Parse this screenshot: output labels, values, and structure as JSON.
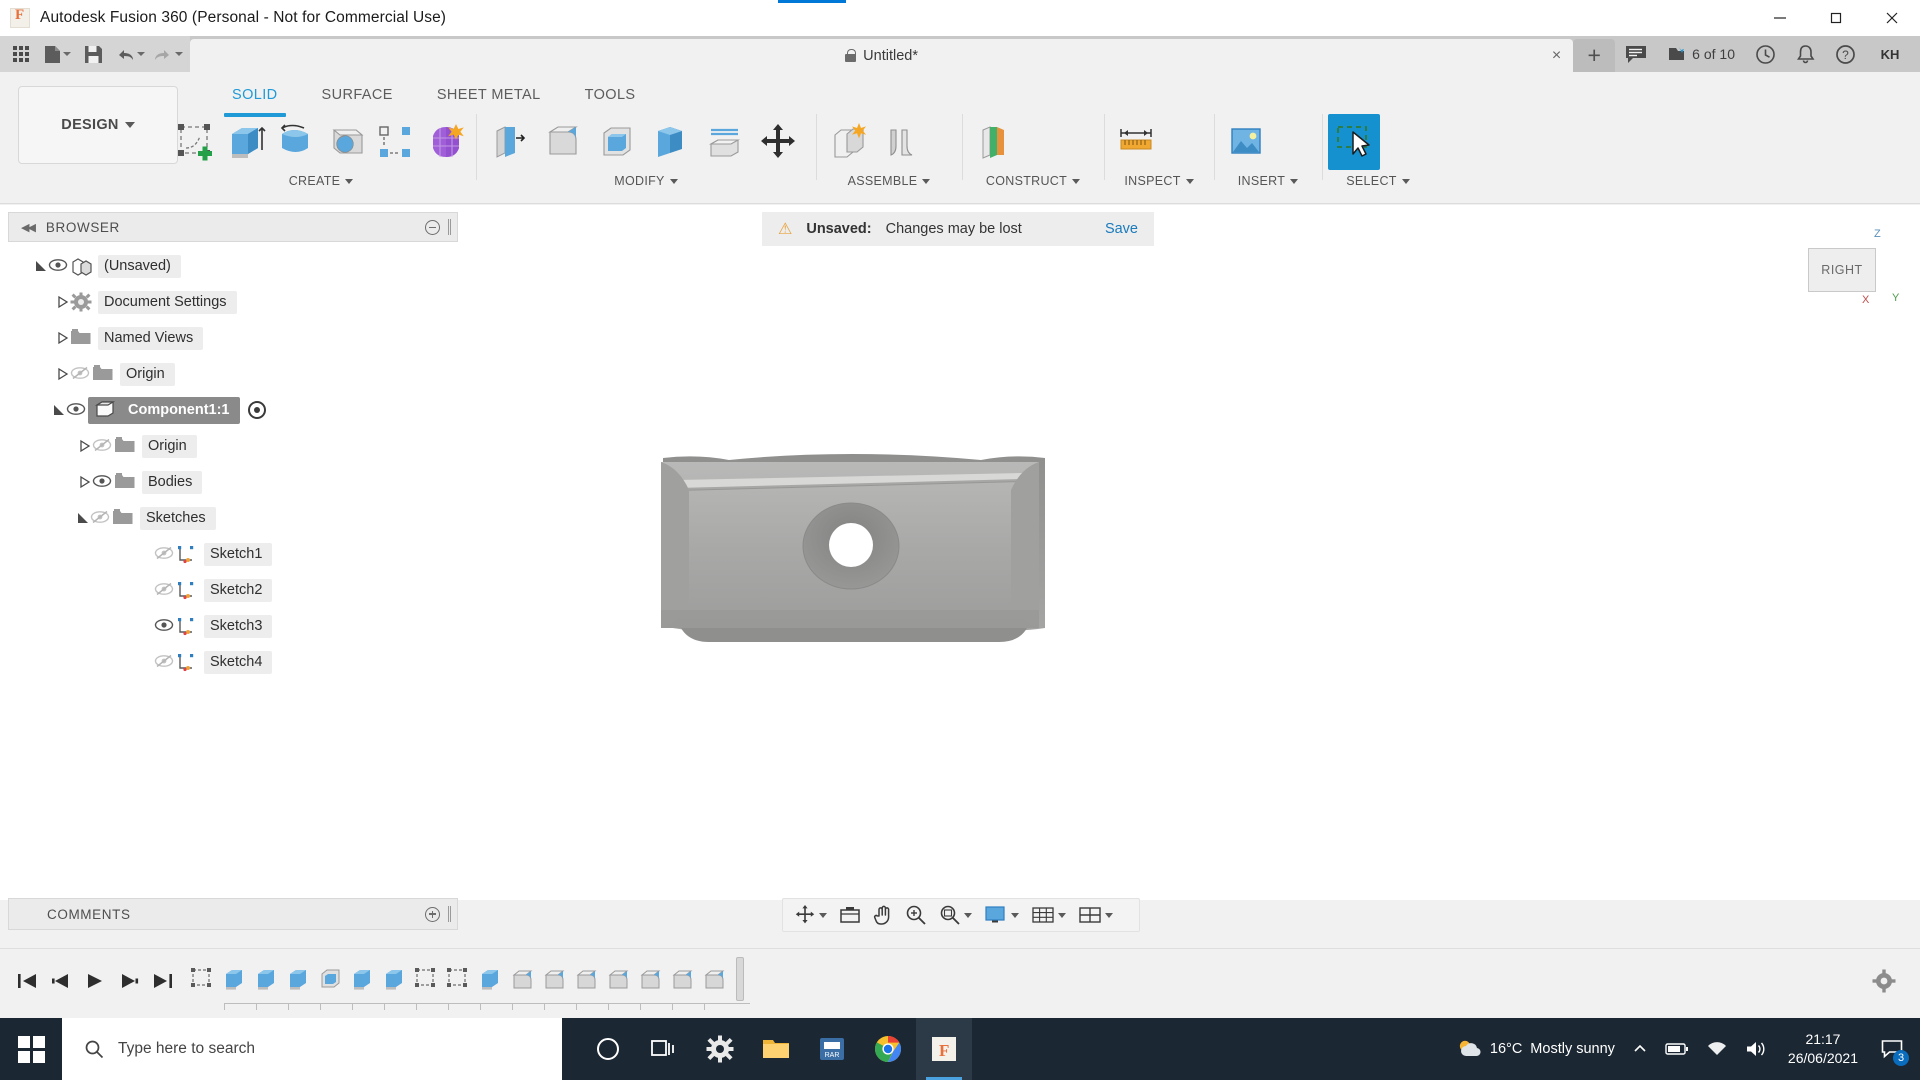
{
  "window": {
    "title": "Autodesk Fusion 360 (Personal - Not for Commercial Use)",
    "logo_letter": "F",
    "minimize": "minimize-button",
    "maximize": "maximize-button",
    "close": "close-button"
  },
  "quick_access": {
    "grid_menu": "app-grid",
    "new_file": "new-file",
    "save": "save",
    "undo": "undo",
    "redo": "redo",
    "doc_tab": "Untitled*",
    "tab_close": "×",
    "new_tab": "+",
    "jobs_count": "6 of 10",
    "avatar": "KH"
  },
  "ribbon": {
    "design_label": "DESIGN",
    "workspace_tabs": [
      {
        "label": "SOLID",
        "active": true
      },
      {
        "label": "SURFACE",
        "active": false
      },
      {
        "label": "SHEET METAL",
        "active": false
      },
      {
        "label": "TOOLS",
        "active": false
      }
    ],
    "panels": [
      {
        "label": "CREATE",
        "has_caret": true
      },
      {
        "label": "MODIFY",
        "has_caret": true
      },
      {
        "label": "ASSEMBLE",
        "has_caret": true
      },
      {
        "label": "CONSTRUCT",
        "has_caret": true
      },
      {
        "label": "INSPECT",
        "has_caret": true
      },
      {
        "label": "INSERT",
        "has_caret": true
      },
      {
        "label": "SELECT",
        "has_caret": true
      }
    ]
  },
  "browser": {
    "title": "BROWSER",
    "tree": [
      {
        "label": "(Unsaved)",
        "indent": 0,
        "expanded": true,
        "eye": "visible",
        "icon": "document-icon",
        "selected": false
      },
      {
        "label": "Document Settings",
        "indent": 1,
        "expanded": false,
        "eye": "none",
        "icon": "gear-icon",
        "selected": false
      },
      {
        "label": "Named Views",
        "indent": 1,
        "expanded": false,
        "eye": "none",
        "icon": "folder-icon",
        "selected": false
      },
      {
        "label": "Origin",
        "indent": 1,
        "expanded": false,
        "eye": "hidden",
        "icon": "folder-icon",
        "selected": false
      },
      {
        "label": "Component1:1",
        "indent": 1,
        "expanded": true,
        "eye": "visible",
        "icon": "component-icon",
        "selected": true,
        "radio": true
      },
      {
        "label": "Origin",
        "indent": 2,
        "expanded": false,
        "eye": "hidden",
        "icon": "folder-icon",
        "selected": false
      },
      {
        "label": "Bodies",
        "indent": 2,
        "expanded": false,
        "eye": "visible",
        "icon": "folder-icon",
        "selected": false
      },
      {
        "label": "Sketches",
        "indent": 2,
        "expanded": true,
        "eye": "hidden",
        "icon": "folder-icon",
        "selected": false
      },
      {
        "label": "Sketch1",
        "indent": 3,
        "expanded": null,
        "eye": "hidden",
        "icon": "sketch-icon",
        "selected": false
      },
      {
        "label": "Sketch2",
        "indent": 3,
        "expanded": null,
        "eye": "hidden",
        "icon": "sketch-icon",
        "selected": false
      },
      {
        "label": "Sketch3",
        "indent": 3,
        "expanded": null,
        "eye": "visible",
        "icon": "sketch-icon",
        "selected": false
      },
      {
        "label": "Sketch4",
        "indent": 3,
        "expanded": null,
        "eye": "hidden",
        "icon": "sketch-icon",
        "selected": false
      }
    ]
  },
  "banner": {
    "status_label": "Unsaved:",
    "message": "Changes may be lost",
    "action": "Save"
  },
  "viewcube": {
    "face": "RIGHT",
    "axis_z": "Z",
    "axis_x": "X",
    "axis_y": "Y"
  },
  "comments": {
    "title": "COMMENTS"
  },
  "navbar": {
    "items": [
      "orbit-tool",
      "look-at-tool",
      "pan-tool",
      "zoom-tool",
      "zoom-window-tool",
      "display-settings",
      "grid-snaps",
      "viewports"
    ]
  },
  "timeline": {
    "controls": [
      "skip-to-beginning",
      "step-back",
      "play",
      "step-forward",
      "skip-to-end"
    ],
    "feature_count": 17,
    "settings": "timeline-settings"
  },
  "taskbar": {
    "search_placeholder": "Type here to search",
    "weather_temp": "16°C",
    "weather_desc": "Mostly sunny",
    "time": "21:17",
    "date": "26/06/2021",
    "notification_count": "3",
    "apps": [
      "cortana-icon",
      "task-view-icon",
      "settings-icon",
      "file-explorer-icon",
      "winrar-icon",
      "chrome-icon",
      "fusion360-icon"
    ]
  },
  "colors": {
    "accent_blue": "#1f9ad6",
    "select_blue": "#1691cf",
    "link_blue": "#1a7bbd",
    "warn_orange": "#e8a33d",
    "taskbar_bg": "#1b2733",
    "ribbon_bg": "#f1f1f1"
  }
}
